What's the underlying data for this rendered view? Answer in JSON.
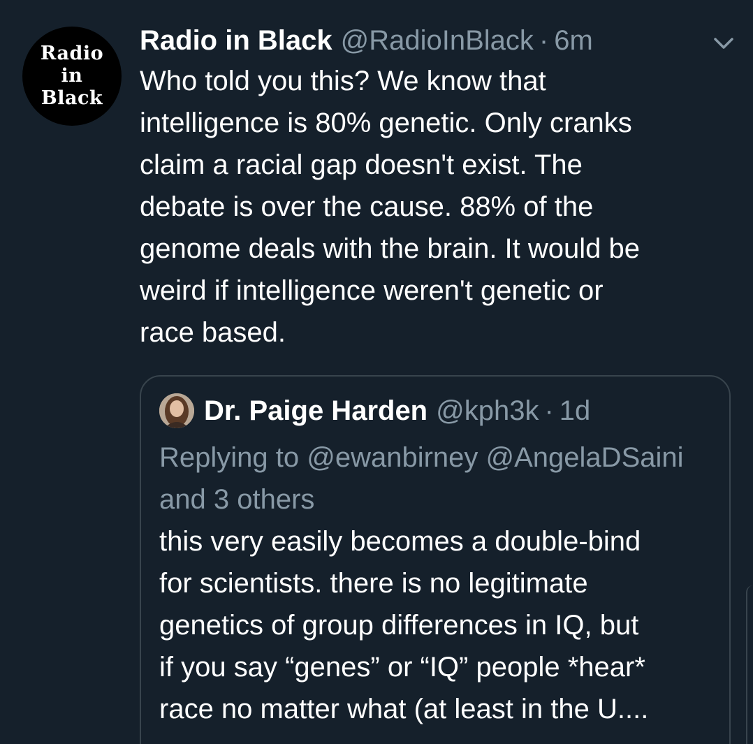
{
  "tweet": {
    "avatar_lines": [
      "Radio",
      "in",
      "Black"
    ],
    "display_name": "Radio in Black",
    "handle": "@RadioInBlack",
    "separator": "·",
    "time": "6m",
    "menu_icon": "chevron-down-icon",
    "text": "Who told you this? We know that\nintelligence is 80% genetic. Only cranks\nclaim a racial gap doesn't exist. The\ndebate is over the cause. 88% of the\ngenome deals with the brain. It would be\nweird if intelligence weren't genetic or\nrace based."
  },
  "quoted_tweet": {
    "display_name": "Dr. Paige Harden",
    "handle": "@kph3k",
    "separator": "·",
    "time": "1d",
    "reply_context": "Replying to @ewanbirney @AngelaDSaini and 3 others",
    "text": "this very easily becomes a double-bind\nfor scientists. there is no legitimate\ngenetics of group differences in IQ, but\nif you say “genes” or “IQ” people *hear*\nrace no matter what (at least in the U...."
  },
  "colors": {
    "background": "#15202b",
    "primary_text": "#ffffff",
    "secondary_text": "#8899a6",
    "border": "#38444d"
  }
}
